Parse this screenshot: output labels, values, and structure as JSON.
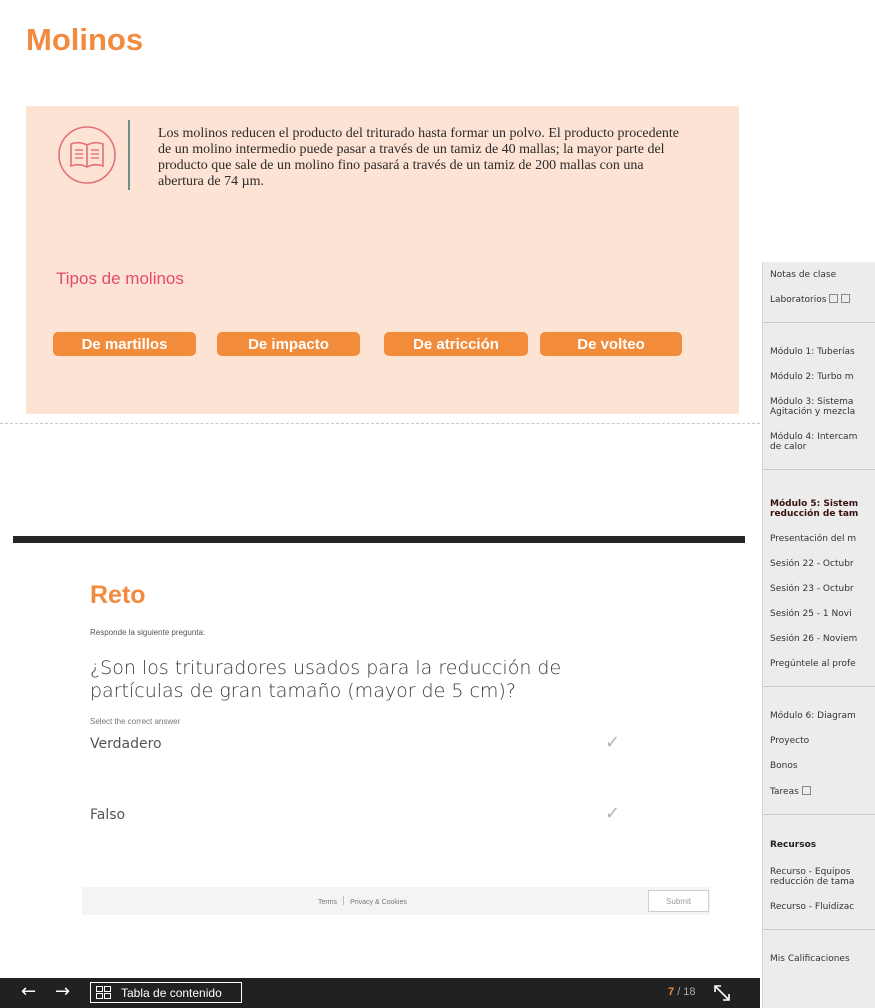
{
  "slide": {
    "title": "Molinos",
    "info_text": "Los molinos reducen el producto del triturado hasta formar un polvo. El producto procedente de un molino intermedio puede pasar a través de un tamiz de 40 mallas; la mayor parte del producto que sale de un molino fino pasará a través de un tamiz de 200 mallas con una abertura de 74 µm.",
    "section_heading": "Tipos de molinos",
    "mill_buttons": [
      "De martillos",
      "De impacto",
      "De atricción",
      "De volteo"
    ],
    "colors": {
      "accent": "#f28b40",
      "panel": "#fde3d3",
      "heading_pink": "#e64a6e",
      "button": "#f28b3a"
    },
    "icons": {
      "book": "open-book-icon"
    }
  },
  "sidebar": {
    "items": [
      "Notas de clase",
      "Laboratorios",
      "Módulo 1: Tuberías",
      "Módulo 2: Turbo m",
      "Módulo 3: Sistema",
      "Agitación y mezcla",
      "Módulo 4: Intercam",
      "de calor",
      "Módulo 5: Sistem",
      "reducción de tam",
      "Presentación del m",
      "Sesión 22 - Octubr",
      "Sesión 23 - Octubr",
      "Sesión 25 - 1 Novi",
      "Sesión 26 - Noviem",
      "Pregúntele al profe",
      "Módulo 6: Diagram",
      "Proyecto",
      "Bonos",
      "Tareas",
      "Recursos",
      "Recurso - Equipos",
      "reducción de tama",
      "Recurso - Fluidizac",
      "Mis Calificaciones"
    ]
  },
  "quiz": {
    "title": "Reto",
    "instruction": "Responde la siguiente pregunta:",
    "question": "¿Son los trituradores usados para la reducción de partículas de gran tamaño (mayor de 5 cm)?",
    "select_label": "Select the correct answer",
    "answers": [
      "Verdadero",
      "Falso"
    ],
    "footer": {
      "terms": "Terms",
      "privacy": "Privacy & Cookies",
      "submit": "Submit"
    }
  },
  "player": {
    "toc_label": "Tabla de contenido",
    "page_current": "7",
    "page_total": "/ 18",
    "icons": {
      "back": "arrow-left-icon",
      "forward": "arrow-right-icon",
      "toc": "grid-icon",
      "fullscreen": "expand-icon"
    }
  }
}
